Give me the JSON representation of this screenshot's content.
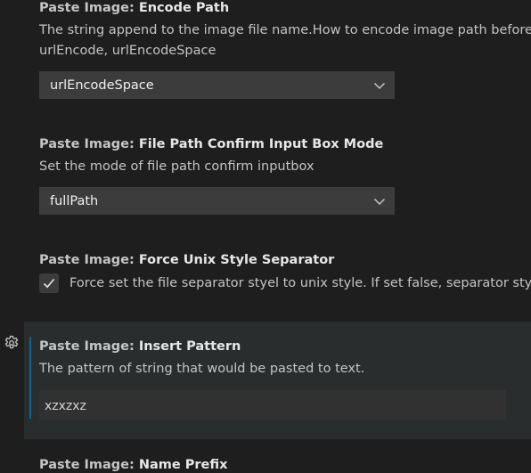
{
  "settings": {
    "encode_path": {
      "category": "Paste Image: ",
      "name": "Encode Path",
      "desc_line1": "The string append to the image file name.How to encode image path before",
      "desc_line2": "urlEncode, urlEncodeSpace",
      "value": "urlEncodeSpace",
      "dropdown_icon": "chevron-down-icon"
    },
    "file_path_confirm": {
      "category": "Paste Image: ",
      "name": "File Path Confirm Input Box Mode",
      "desc": "Set the mode of file path confirm inputbox",
      "value": "fullPath",
      "dropdown_icon": "chevron-down-icon"
    },
    "force_unix": {
      "category": "Paste Image: ",
      "name": "Force Unix Style Separator",
      "checked": true,
      "label": "Force set the file separator styel to unix style. If set false, separator styel w"
    },
    "insert_pattern": {
      "category": "Paste Image: ",
      "name": "Insert Pattern",
      "desc": "The pattern of string that would be pasted to text.",
      "value": "xzxzxz",
      "gear_icon": "gear-icon"
    },
    "name_prefix": {
      "category": "Paste Image: ",
      "name": "Name Prefix"
    }
  },
  "colors": {
    "background": "#1e1e1e",
    "focused_row": "#2a2d2e",
    "accent": "#0e639c",
    "input_bg": "#3c3c3c"
  }
}
